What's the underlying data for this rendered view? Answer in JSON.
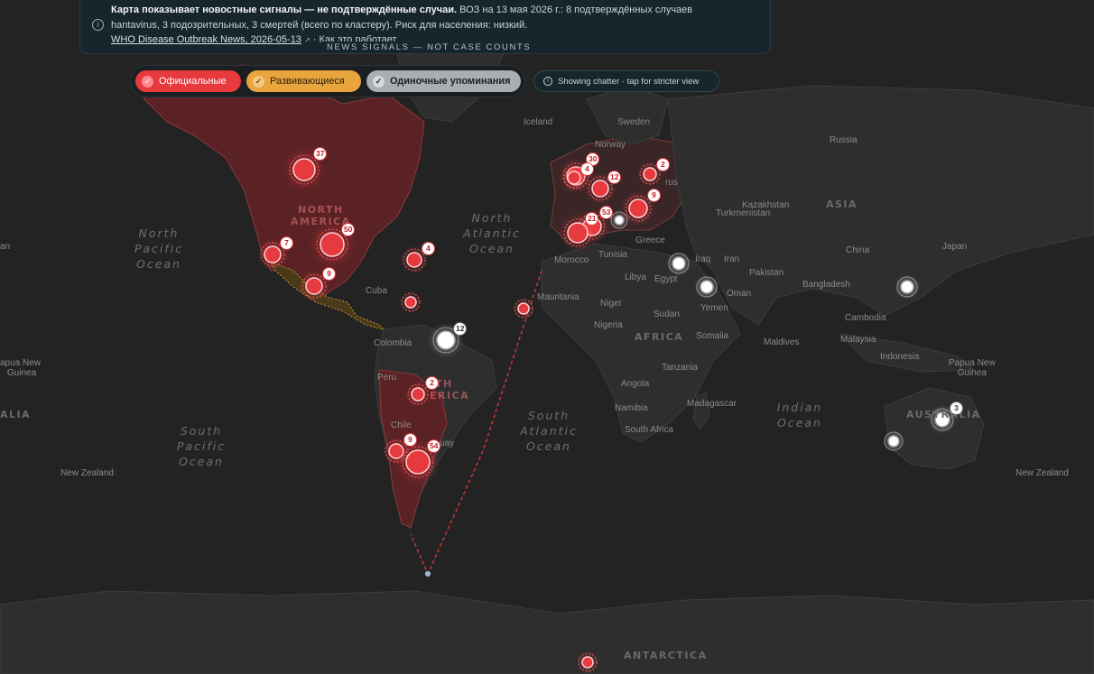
{
  "banner": {
    "headline": "Карта показывает новостные сигналы — не подтверждённые случаи.",
    "body_line1": "ВОЗ на 13 мая 2026 г.: 8 подтверждённых случаев",
    "body_line2": "hantavirus, 3 подозрительных, 3 смертей (всего по кластеру). Риск для населения: низкий.",
    "source_link": "WHO Disease Outbreak News, 2026-05-13",
    "how_it_works": "· Как это работает"
  },
  "tag": "NEWS SIGNALS — NOT CASE COUNTS",
  "filters": [
    {
      "label": "Официальные",
      "checked": true,
      "color": "#e63a3f"
    },
    {
      "label": "Развивающиеся",
      "checked": true,
      "color": "#e9a53d"
    },
    {
      "label": "Одиночные упоминания",
      "checked": true,
      "color": "#a8aeb3"
    }
  ],
  "chatter_hint": "Showing chatter · tap for stricter view",
  "colors": {
    "official": "#e63a3f",
    "developing": "#e9a53d",
    "single": "#ffffff",
    "ocean": "#232323",
    "land": "#2e2e2e"
  },
  "oceans": [
    {
      "l1": "North",
      "l2": "Pacific",
      "l3": "Ocean"
    },
    {
      "l1": "North",
      "l2": "Atlantic",
      "l3": "Ocean"
    },
    {
      "l1": "South",
      "l2": "Pacific",
      "l3": "Ocean"
    },
    {
      "l1": "South",
      "l2": "Atlantic",
      "l3": "Ocean"
    },
    {
      "l1": "Indian",
      "l2": "Ocean",
      "l3": ""
    }
  ],
  "regions": {
    "north_america": "NORTH AMERICA",
    "north_america_l1": "NORTH",
    "north_america_l2": "AMERICA",
    "south_america_l1": "TH",
    "south_america_l2": "ERICA",
    "asia": "ASIA",
    "africa": "AFRICA",
    "australia": "AUSTRALIA",
    "antarctica": "ANTARCTICA",
    "australia_left": "ALIA"
  },
  "places": {
    "iceland": "Iceland",
    "sweden": "Sweden",
    "norway": "Norway",
    "russia": "Russia",
    "belarus": "rus",
    "kazakhstan": "Kazakhstan",
    "turkmenistan": "Turkmenistan",
    "china": "China",
    "japan": "Japan",
    "greece": "Greece",
    "morocco": "Morocco",
    "tunisia": "Tunisia",
    "libya": "Libya",
    "egypt": "Egypt",
    "iraq": "Iraq",
    "iran": "Iran",
    "pakistan": "Pakistan",
    "oman": "Oman",
    "yemen": "Yemen",
    "bangladesh": "Bangladesh",
    "cambodia": "Cambodia",
    "malaysia": "Malaysia",
    "indonesia": "Indonesia",
    "maldives": "Maldives",
    "mauritania": "Mauritania",
    "niger": "Niger",
    "nigeria": "Nigeria",
    "sudan": "Sudan",
    "somalia": "Somalia",
    "tanzania": "Tanzania",
    "angola": "Angola",
    "madagascar": "Madagascar",
    "namibia": "Namibia",
    "south_africa": "South Africa",
    "cuba": "Cuba",
    "colombia": "Colombia",
    "peru": "Peru",
    "chile": "Chile",
    "uruguay": "uay",
    "png_left": "apua New",
    "png_left2": "Guinea",
    "png_right": "Papua New",
    "png_right2": "Guinea",
    "nz_left": "New Zealand",
    "nz_right": "New Zealand",
    "japan_left": "an"
  },
  "signals": [
    {
      "type": "official",
      "label": "37"
    },
    {
      "type": "official",
      "label": "50"
    },
    {
      "type": "official",
      "label": "7"
    },
    {
      "type": "official",
      "label": "9"
    },
    {
      "type": "official",
      "label": "4"
    },
    {
      "type": "official",
      "label": ""
    },
    {
      "type": "official",
      "label": ""
    },
    {
      "type": "single",
      "label": "12"
    },
    {
      "type": "official",
      "label": "2"
    },
    {
      "type": "official",
      "label": "9"
    },
    {
      "type": "official",
      "label": "54"
    },
    {
      "type": "official",
      "label": "30"
    },
    {
      "type": "official",
      "label": "4"
    },
    {
      "type": "official",
      "label": "12"
    },
    {
      "type": "official",
      "label": "2"
    },
    {
      "type": "official",
      "label": "9"
    },
    {
      "type": "official",
      "label": "53"
    },
    {
      "type": "official",
      "label": "21"
    },
    {
      "type": "single",
      "label": ""
    },
    {
      "type": "single",
      "label": ""
    },
    {
      "type": "single",
      "label": ""
    },
    {
      "type": "single",
      "label": ""
    },
    {
      "type": "single",
      "label": "3"
    },
    {
      "type": "single",
      "label": ""
    },
    {
      "type": "official",
      "label": ""
    }
  ]
}
